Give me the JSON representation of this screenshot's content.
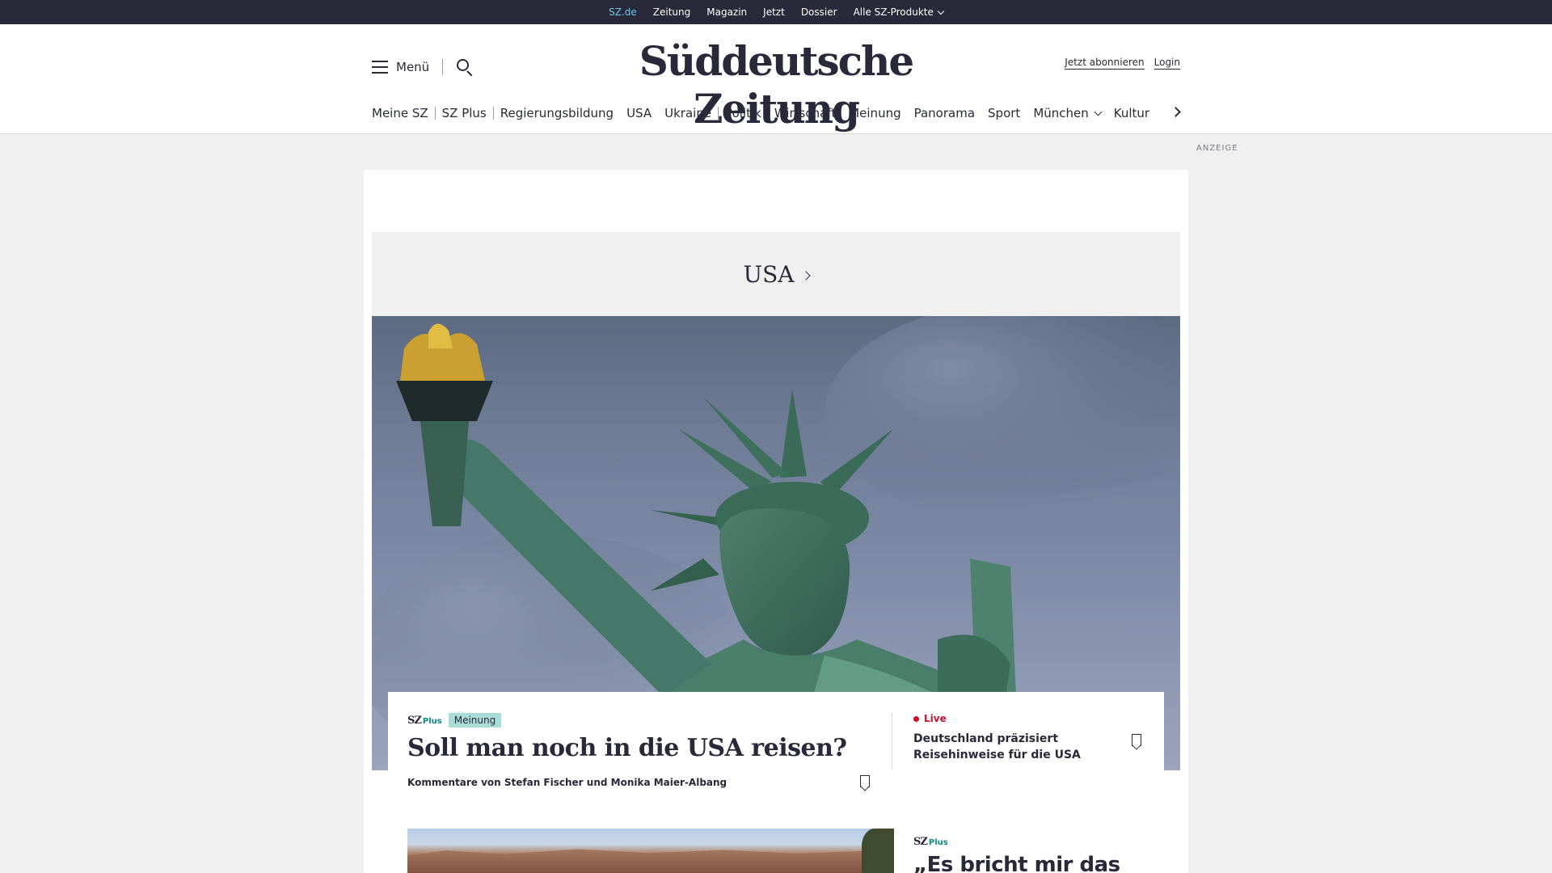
{
  "topbar": {
    "items": [
      "SZ.de",
      "Zeitung",
      "Magazin",
      "Jetzt",
      "Dossier",
      "Alle SZ-Produkte"
    ]
  },
  "header": {
    "menu_label": "Menü",
    "logo": "Süddeutsche Zeitung",
    "subscribe": "Jetzt abonnieren",
    "login": "Login"
  },
  "nav": {
    "items": [
      "Meine SZ",
      "SZ Plus",
      "Regierungsbildung",
      "USA",
      "Ukraine",
      "Politik",
      "Wirtschaft",
      "Meinung",
      "Panorama",
      "Sport",
      "München",
      "Kultur"
    ]
  },
  "ad_label": "ANZEIGE",
  "section": {
    "title": "USA"
  },
  "lead": {
    "brand_sz": "SZ",
    "brand_plus": "Plus",
    "tag": "Meinung",
    "headline": "Soll man noch in die USA reisen?",
    "byline": "Kommentare von Stefan Fischer und Monika Maier-Albang"
  },
  "side": {
    "live_label": "Live",
    "title": "Deutschland präzisiert Reisehinweise für die USA"
  },
  "second": {
    "brand_sz": "SZ",
    "brand_plus": "Plus",
    "headline": "„Es bricht mir das"
  },
  "colors": {
    "topbar_bg": "#29293a",
    "accent_teal": "#0a8a83",
    "tag_bg": "#a9dcd7",
    "live_red": "#c8102e",
    "active_link": "#71c5e8"
  }
}
